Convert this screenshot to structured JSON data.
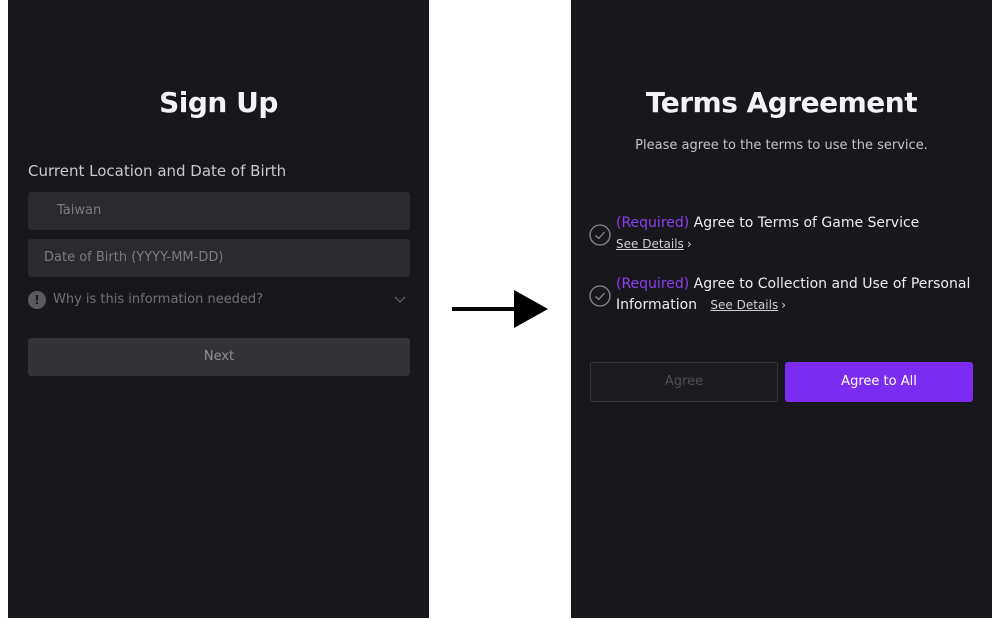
{
  "signup": {
    "title": "Sign Up",
    "section_label": "Current Location and Date of Birth",
    "country_value": "Taiwan",
    "dob_placeholder": "Date of Birth (YYYY-MM-DD)",
    "info_text": "Why is this information needed?",
    "info_icon_glyph": "!",
    "next_label": "Next"
  },
  "terms": {
    "title": "Terms Agreement",
    "subtitle": "Please agree to the terms to use the service.",
    "items": [
      {
        "required_tag": "(Required)",
        "label": " Agree to Terms of Game Service",
        "details_label": "See Details"
      },
      {
        "required_tag": "(Required)",
        "label": " Agree to Collection and Use of Personal Information",
        "details_label": "See Details"
      }
    ],
    "agree_label": "Agree",
    "agree_all_label": "Agree to All"
  },
  "icons": {
    "chevron": "chevron-right-icon",
    "check": "check-circle-icon",
    "arrow": "right-arrow-icon",
    "info": "info-icon",
    "dropdown": "chevron-down-icon"
  },
  "colors": {
    "panel_bg": "#18181c",
    "field_bg": "#2a2a2f",
    "accent": "#7b2cf0",
    "required_text": "#8a3ff0"
  }
}
